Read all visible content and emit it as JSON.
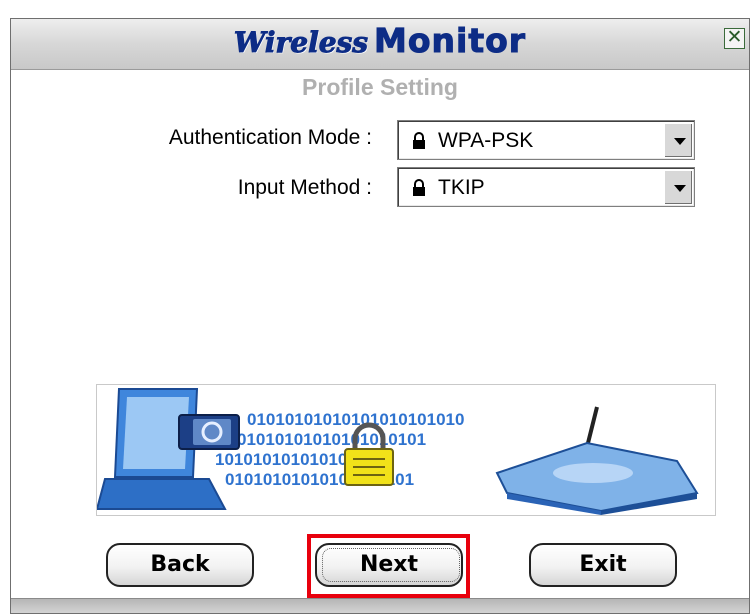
{
  "window": {
    "title_part1": "Wireless",
    "title_part2": "Monitor",
    "close_symbol": "✕"
  },
  "page": {
    "subtitle": "Profile Setting"
  },
  "form": {
    "auth_mode": {
      "label": "Authentication Mode :",
      "value": "WPA-PSK",
      "icon": "lock-icon"
    },
    "input_method": {
      "label": "Input Method :",
      "value": "TKIP",
      "icon": "lock-icon"
    }
  },
  "banner": {
    "binary_rows": [
      "01010101010101010101010",
      "01010101010101010101",
      "10101010101010101",
      "01010101010101010101"
    ],
    "icons": [
      "laptop-icon",
      "padlock-icon",
      "router-icon"
    ]
  },
  "buttons": {
    "back": "Back",
    "next": "Next",
    "exit": "Exit"
  },
  "colors": {
    "title": "#0d2c86",
    "subtitle": "#b0b0b0",
    "highlight": "#e8000d",
    "binary": "#2f73cf"
  }
}
